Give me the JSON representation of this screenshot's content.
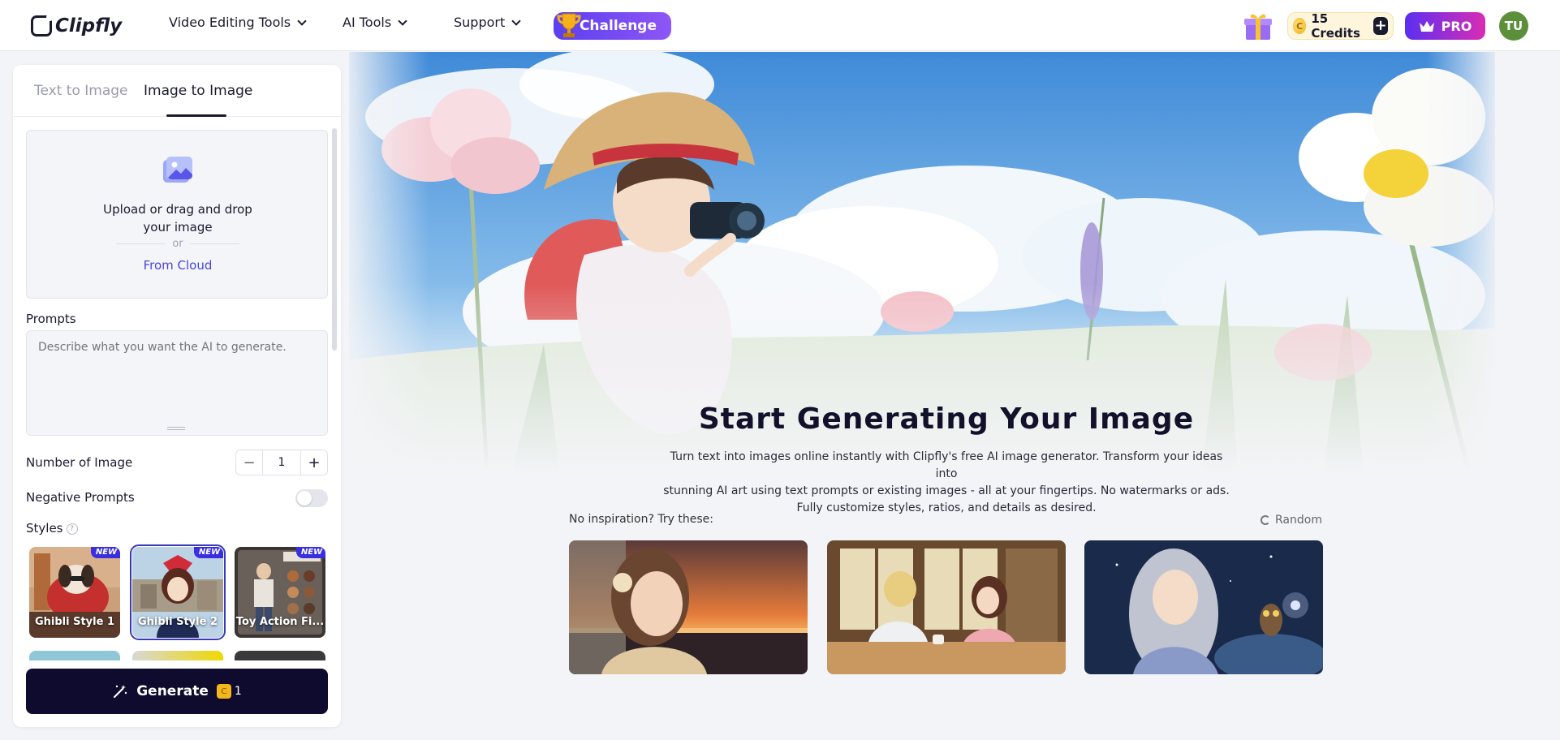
{
  "header": {
    "logo": "Clipfly",
    "nav": [
      {
        "label": "Video Editing Tools"
      },
      {
        "label": "AI Tools"
      },
      {
        "label": "Support"
      }
    ],
    "challenge_label": "Challenge",
    "credits_label": "15 Credits",
    "pro_label": "PRO",
    "avatar_initials": "TU"
  },
  "panel": {
    "tabs": [
      {
        "label": "Text to Image",
        "active": false
      },
      {
        "label": "Image to Image",
        "active": true
      }
    ],
    "upload": {
      "line1": "Upload or drag and drop",
      "line2": "your image",
      "or": "or",
      "cloud": "From Cloud"
    },
    "prompts_label": "Prompts",
    "prompt_placeholder": "Describe what you want the AI to generate.",
    "number_label": "Number of Image",
    "number_value": "1",
    "negative_label": "Negative Prompts",
    "negative_enabled": false,
    "styles_label": "Styles",
    "styles": [
      {
        "name": "Ghibli Style 1",
        "badge": "NEW",
        "selected": false
      },
      {
        "name": "Ghibli Style 2",
        "badge": "NEW",
        "selected": true
      },
      {
        "name": "Toy Action Fi...",
        "badge": "NEW",
        "selected": false
      }
    ],
    "generate_label": "Generate",
    "generate_cost": "1"
  },
  "hero": {
    "title": "Start Generating Your Image",
    "description_line1": "Turn text into images online instantly with Clipfly's free AI image generator. Transform your ideas into",
    "description_line2": "stunning AI art using text prompts or existing images - all at your fingertips. No watermarks or ads.",
    "description_line3": "Fully customize styles, ratios, and details as desired.",
    "inspiration_label": "No inspiration? Try these:",
    "random_label": "Random"
  },
  "colors": {
    "accent": "#4a45d8",
    "generate_bg": "#0e0b2e",
    "challenge_bg": "#6a47f2",
    "pro_gradient_start": "#5a2ff0",
    "pro_gradient_end": "#d92db4"
  },
  "icons": [
    "chevron-down-icon",
    "trophy-icon",
    "gift-icon",
    "coin-icon",
    "plus-icon",
    "crown-icon",
    "image-upload-icon",
    "minus-icon",
    "help-icon",
    "magic-wand-icon",
    "refresh-icon"
  ]
}
